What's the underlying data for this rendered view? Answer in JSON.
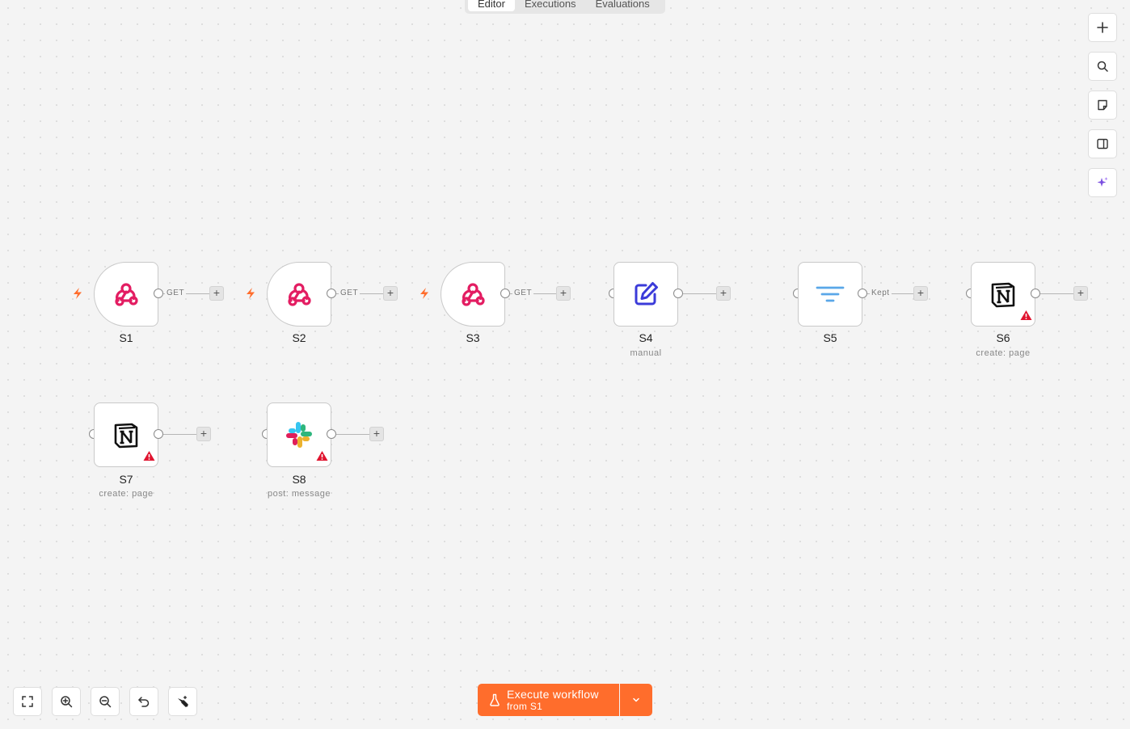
{
  "tabs": [
    {
      "label": "Editor",
      "active": true
    },
    {
      "label": "Executions",
      "active": false
    },
    {
      "label": "Evaluations",
      "active": false
    }
  ],
  "right_toolbar": [
    "plus-icon",
    "search-icon",
    "sticky-note-icon",
    "panel-icon",
    "ai-sparkle-icon"
  ],
  "nodes": [
    {
      "id": "S1",
      "name": "S1",
      "subtitle": "",
      "icon": "webhook-icon",
      "trigger": true,
      "edge_label": "GET",
      "warning": false
    },
    {
      "id": "S2",
      "name": "S2",
      "subtitle": "",
      "icon": "webhook-icon",
      "trigger": true,
      "edge_label": "GET",
      "warning": false
    },
    {
      "id": "S3",
      "name": "S3",
      "subtitle": "",
      "icon": "webhook-icon",
      "trigger": true,
      "edge_label": "GET",
      "warning": false
    },
    {
      "id": "S4",
      "name": "S4",
      "subtitle": "manual",
      "icon": "edit-icon",
      "trigger": false,
      "edge_label": "",
      "warning": false
    },
    {
      "id": "S5",
      "name": "S5",
      "subtitle": "",
      "icon": "filter-icon",
      "trigger": false,
      "edge_label": "Kept",
      "warning": false
    },
    {
      "id": "S6",
      "name": "S6",
      "subtitle": "create: page",
      "icon": "notion-icon",
      "trigger": false,
      "edge_label": "",
      "warning": true
    },
    {
      "id": "S7",
      "name": "S7",
      "subtitle": "create: page",
      "icon": "notion-icon",
      "trigger": false,
      "edge_label": "",
      "warning": true
    },
    {
      "id": "S8",
      "name": "S8",
      "subtitle": "post: message",
      "icon": "slack-icon",
      "trigger": false,
      "edge_label": "",
      "warning": true
    }
  ],
  "bottom_toolbar": [
    "fit-view-icon",
    "zoom-in-icon",
    "zoom-out-icon",
    "undo-icon",
    "tidy-up-icon"
  ],
  "execute": {
    "label": "Execute workflow",
    "sublabel": "from S1"
  },
  "colors": {
    "accent": "#ff6d2c",
    "webhook": "#e31d62",
    "edit": "#3b3bd9",
    "filter": "#5aa7e8",
    "warning": "#e0142f",
    "bolt": "#ff6d2c"
  }
}
